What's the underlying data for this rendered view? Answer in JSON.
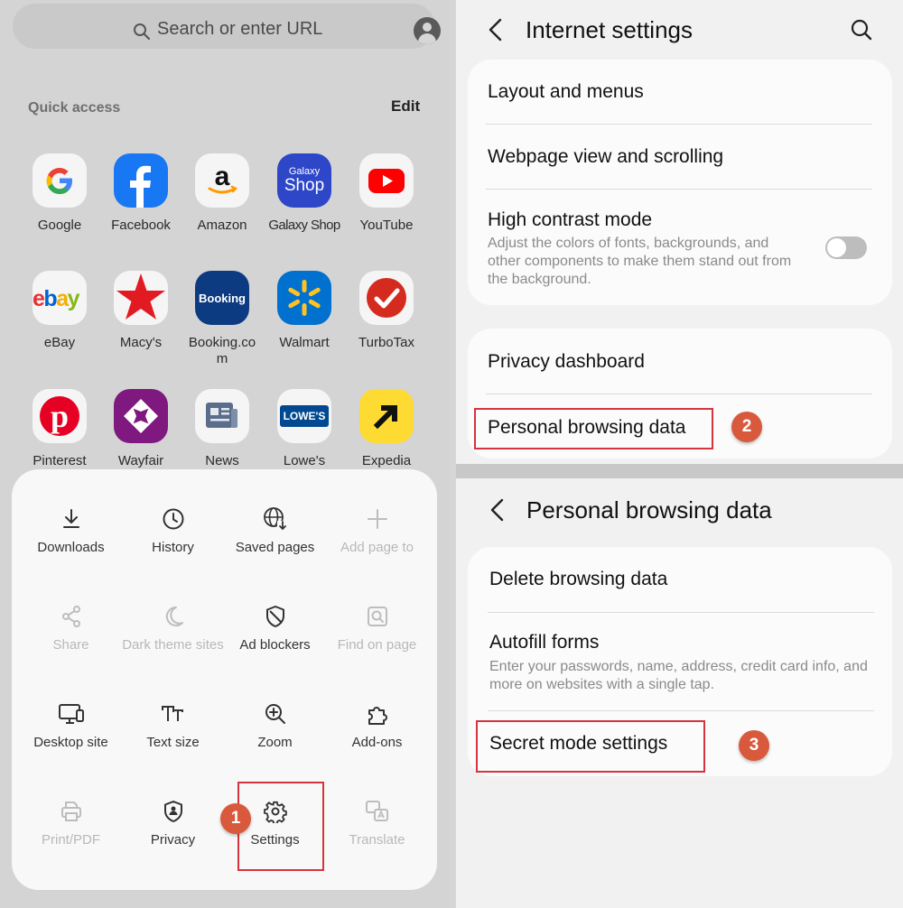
{
  "browser": {
    "search_placeholder": "Search or enter URL",
    "quick_access_title": "Quick access",
    "edit_label": "Edit",
    "quick_access": [
      {
        "label": "Google",
        "icon": "google-icon"
      },
      {
        "label": "Facebook",
        "icon": "facebook-icon"
      },
      {
        "label": "Amazon",
        "icon": "amazon-icon"
      },
      {
        "label": "Galaxy Shop",
        "icon": "galaxy-shop-icon",
        "icon_text_1": "Galaxy",
        "icon_text_2": "Shop"
      },
      {
        "label": "YouTube",
        "icon": "youtube-icon"
      },
      {
        "label": "eBay",
        "icon": "ebay-icon"
      },
      {
        "label": "Macy's",
        "icon": "macys-star-icon"
      },
      {
        "label": "Booking.co\nm",
        "icon": "booking-icon",
        "icon_text": "Booking"
      },
      {
        "label": "Walmart",
        "icon": "walmart-spark-icon"
      },
      {
        "label": "TurboTax",
        "icon": "turbotax-check-icon"
      },
      {
        "label": "Pinterest",
        "icon": "pinterest-icon"
      },
      {
        "label": "Wayfair",
        "icon": "wayfair-icon"
      },
      {
        "label": "News",
        "icon": "news-icon"
      },
      {
        "label": "Lowe's",
        "icon": "lowes-icon",
        "icon_text": "LOWE'S"
      },
      {
        "label": "Expedia",
        "icon": "expedia-icon"
      }
    ],
    "menu": [
      {
        "label": "Downloads",
        "icon": "download-icon",
        "enabled": true
      },
      {
        "label": "History",
        "icon": "clock-icon",
        "enabled": true
      },
      {
        "label": "Saved pages",
        "icon": "globe-download-icon",
        "enabled": true
      },
      {
        "label": "Add page to",
        "icon": "plus-icon",
        "enabled": false
      },
      {
        "label": "Share",
        "icon": "share-icon",
        "enabled": false
      },
      {
        "label": "Dark theme sites",
        "icon": "moon-icon",
        "enabled": false
      },
      {
        "label": "Ad blockers",
        "icon": "shield-icon",
        "enabled": true
      },
      {
        "label": "Find on page",
        "icon": "find-page-icon",
        "enabled": false
      },
      {
        "label": "Desktop site",
        "icon": "desktop-icon",
        "enabled": true
      },
      {
        "label": "Text size",
        "icon": "text-size-icon",
        "enabled": true
      },
      {
        "label": "Zoom",
        "icon": "zoom-in-icon",
        "enabled": true
      },
      {
        "label": "Add-ons",
        "icon": "puzzle-icon",
        "enabled": true
      },
      {
        "label": "Print/PDF",
        "icon": "printer-icon",
        "enabled": false
      },
      {
        "label": "Privacy",
        "icon": "privacy-shield-icon",
        "enabled": true
      },
      {
        "label": "Settings",
        "icon": "gear-icon",
        "enabled": true
      },
      {
        "label": "Translate",
        "icon": "translate-icon",
        "enabled": false
      }
    ],
    "step_1": "1"
  },
  "internet_settings": {
    "title": "Internet settings",
    "layout_menus": "Layout and menus",
    "webpage_view": "Webpage view and scrolling",
    "high_contrast_title": "High contrast mode",
    "high_contrast_desc": "Adjust the colors of fonts, backgrounds, and other components to make them stand out from the background.",
    "high_contrast_on": false,
    "privacy_dashboard": "Privacy dashboard",
    "personal_browsing_data": "Personal browsing data",
    "step_2": "2"
  },
  "personal_browsing": {
    "title": "Personal browsing data",
    "delete_browsing_data": "Delete browsing data",
    "autofill_title": "Autofill forms",
    "autofill_desc": "Enter your passwords, name, address, credit card info, and more on websites with a single tap.",
    "secret_mode": "Secret mode settings",
    "step_3": "3"
  },
  "colors": {
    "highlight_box": "#d6343d",
    "step_badge": "#d9593c"
  }
}
